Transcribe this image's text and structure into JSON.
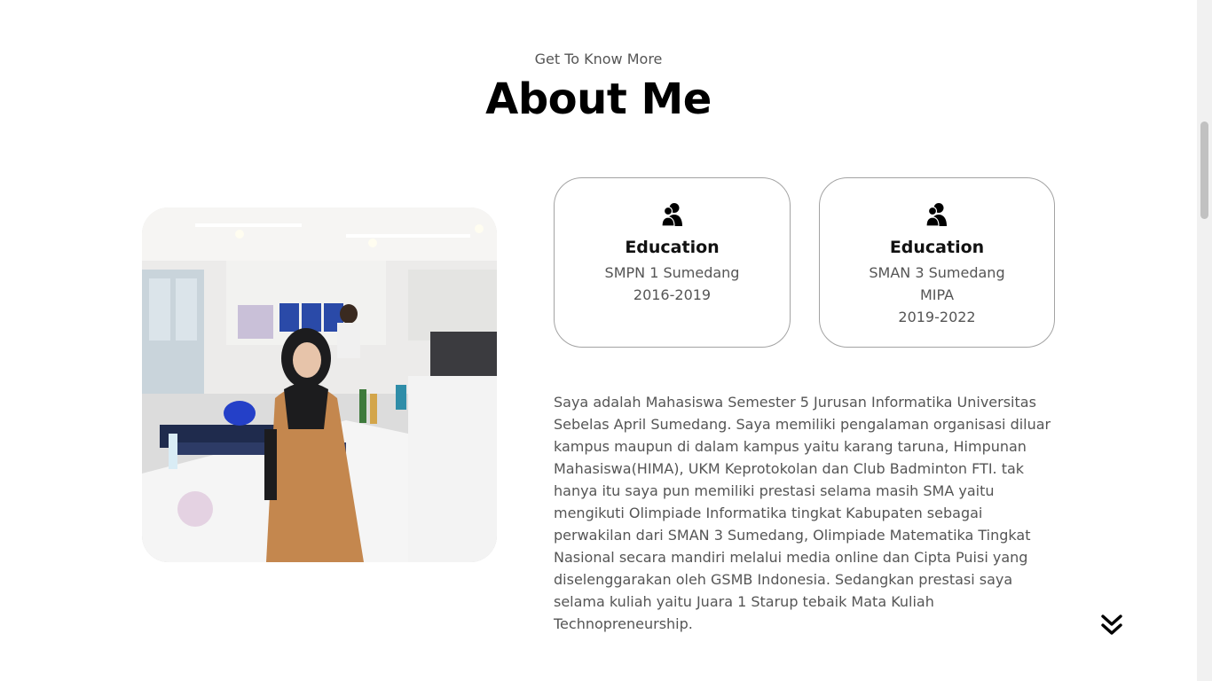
{
  "header": {
    "subtitle": "Get To Know More",
    "title": "About Me"
  },
  "photo": {
    "alt": "Profile photo"
  },
  "cards": [
    {
      "icon": "user-group-icon",
      "title": "Education",
      "lines": [
        "SMPN 1 Sumedang",
        "2016-2019"
      ]
    },
    {
      "icon": "user-group-icon",
      "title": "Education",
      "lines": [
        "SMAN 3 Sumedang",
        "MIPA",
        "2019-2022"
      ]
    }
  ],
  "about": {
    "text": "Saya adalah Mahasiswa Semester 5 Jurusan Informatika Universitas Sebelas April Sumedang. Saya memiliki pengalaman organisasi diluar kampus maupun di dalam kampus yaitu karang taruna, Himpunan Mahasiswa(HIMA), UKM Keprotokolan dan Club Badminton FTI. tak hanya itu saya pun memiliki prestasi selama masih SMA yaitu mengikuti Olimpiade Informatika tingkat Kabupaten sebagai perwakilan dari SMAN 3 Sumedang, Olimpiade Matematika Tingkat Nasional secara mandiri melalui media online dan Cipta Puisi yang diselenggarakan oleh GSMB Indonesia. Sedangkan prestasi saya selama kuliah yaitu Juara 1 Starup tebaik Mata Kuliah Technopreneurship."
  },
  "nav": {
    "scroll_down_icon": "double-chevron-down-icon"
  },
  "colors": {
    "card_border": "#a3a3a3",
    "heading": "#000000",
    "text": "#555555"
  }
}
